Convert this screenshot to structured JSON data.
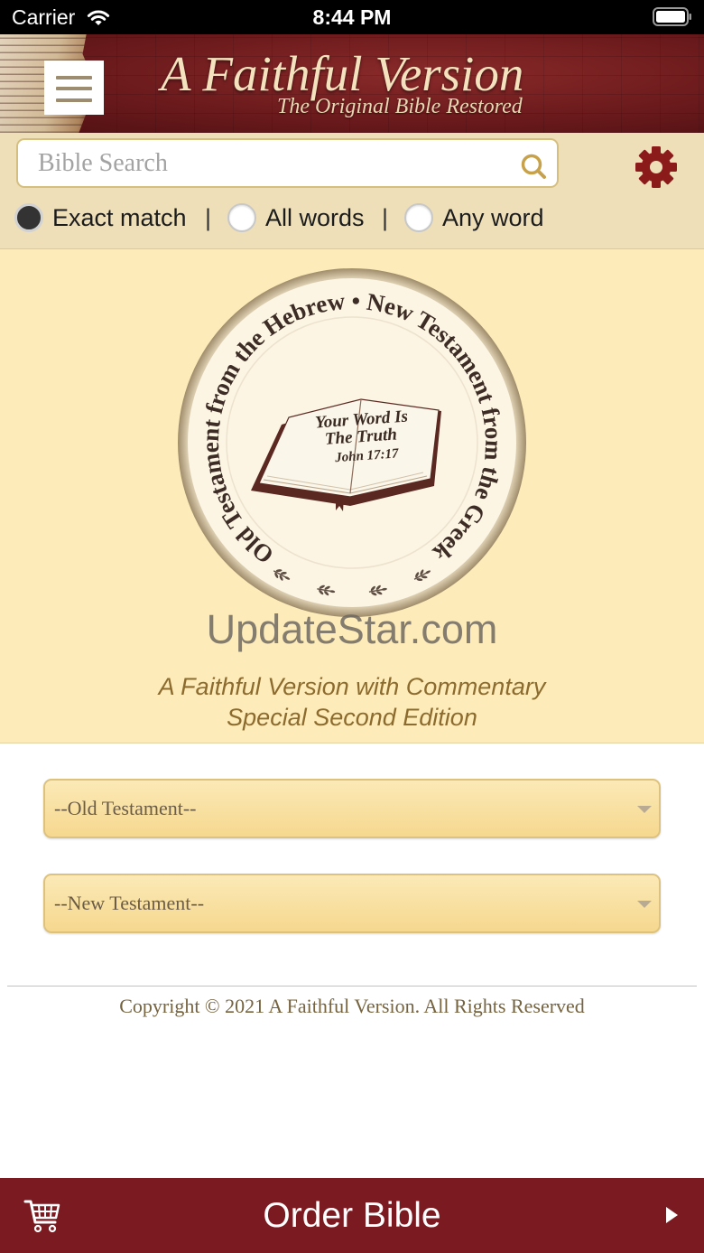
{
  "status_bar": {
    "carrier": "Carrier",
    "time": "8:44 PM",
    "wifi_icon": "wifi-icon",
    "battery_icon": "battery-icon"
  },
  "header": {
    "title": "A Faithful Version",
    "subtitle": "The Original Bible Restored",
    "menu_icon": "hamburger-menu-icon"
  },
  "search": {
    "placeholder": "Bible Search",
    "icon": "search-icon",
    "settings_icon": "gear-icon",
    "separator": "|",
    "modes": [
      {
        "label": "Exact match",
        "selected": true
      },
      {
        "label": "All words",
        "selected": false
      },
      {
        "label": "Any word",
        "selected": false
      }
    ]
  },
  "logo": {
    "ring_text": "Old Testament from the Hebrew • New Testament from the Greek",
    "book_line_1": "Your Word Is",
    "book_line_2": "The Truth",
    "book_reference": "John 17:17",
    "watermark": "UpdateStar.com"
  },
  "edition": {
    "line_1": "A Faithful Version with Commentary",
    "line_2": "Special Second Edition"
  },
  "selects": {
    "old_testament": {
      "selected": "--Old Testament--",
      "icon": "chevron-down-icon"
    },
    "new_testament": {
      "selected": "--New Testament--",
      "icon": "chevron-down-icon"
    }
  },
  "footer": {
    "copyright": "Copyright © 2021 A Faithful Version. All Rights Reserved"
  },
  "order_bar": {
    "label": "Order Bible",
    "cart_icon": "cart-icon",
    "arrow_icon": "play-arrow-icon"
  },
  "colors": {
    "brand_maroon": "#7b1a20",
    "search_panel": "#eedfb9",
    "logo_panel": "#fdecb9",
    "accent_gold": "#c9a44c",
    "edition_text": "#8d6b2e"
  }
}
